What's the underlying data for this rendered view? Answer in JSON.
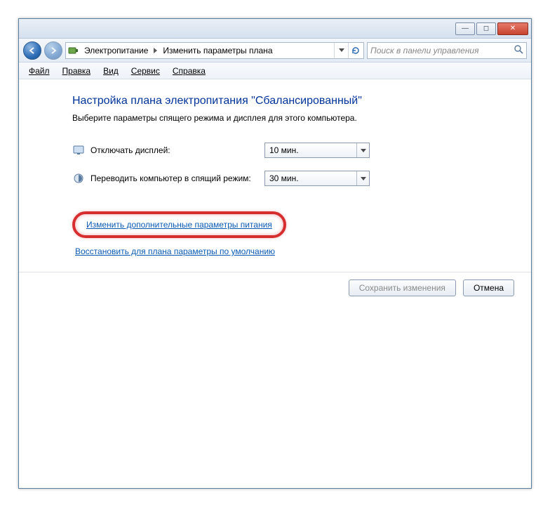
{
  "titlebar": {
    "minimize": "—",
    "maximize": "◻",
    "close": "✕"
  },
  "nav": {
    "crumb1": "Электропитание",
    "crumb2": "Изменить параметры плана",
    "search_placeholder": "Поиск в панели управления"
  },
  "menu": {
    "file": "Файл",
    "edit": "Правка",
    "view": "Вид",
    "tools": "Сервис",
    "help": "Справка"
  },
  "main": {
    "heading": "Настройка плана электропитания \"Сбалансированный\"",
    "subtext": "Выберите параметры спящего режима и дисплея для этого компьютера.",
    "row_display": "Отключать дисплей:",
    "val_display": "10 мин.",
    "row_sleep": "Переводить компьютер в спящий режим:",
    "val_sleep": "30 мин.",
    "link_advanced": "Изменить дополнительные параметры питания",
    "link_restore": "Восстановить для плана параметры по умолчанию"
  },
  "footer": {
    "save": "Сохранить изменения",
    "cancel": "Отмена"
  }
}
